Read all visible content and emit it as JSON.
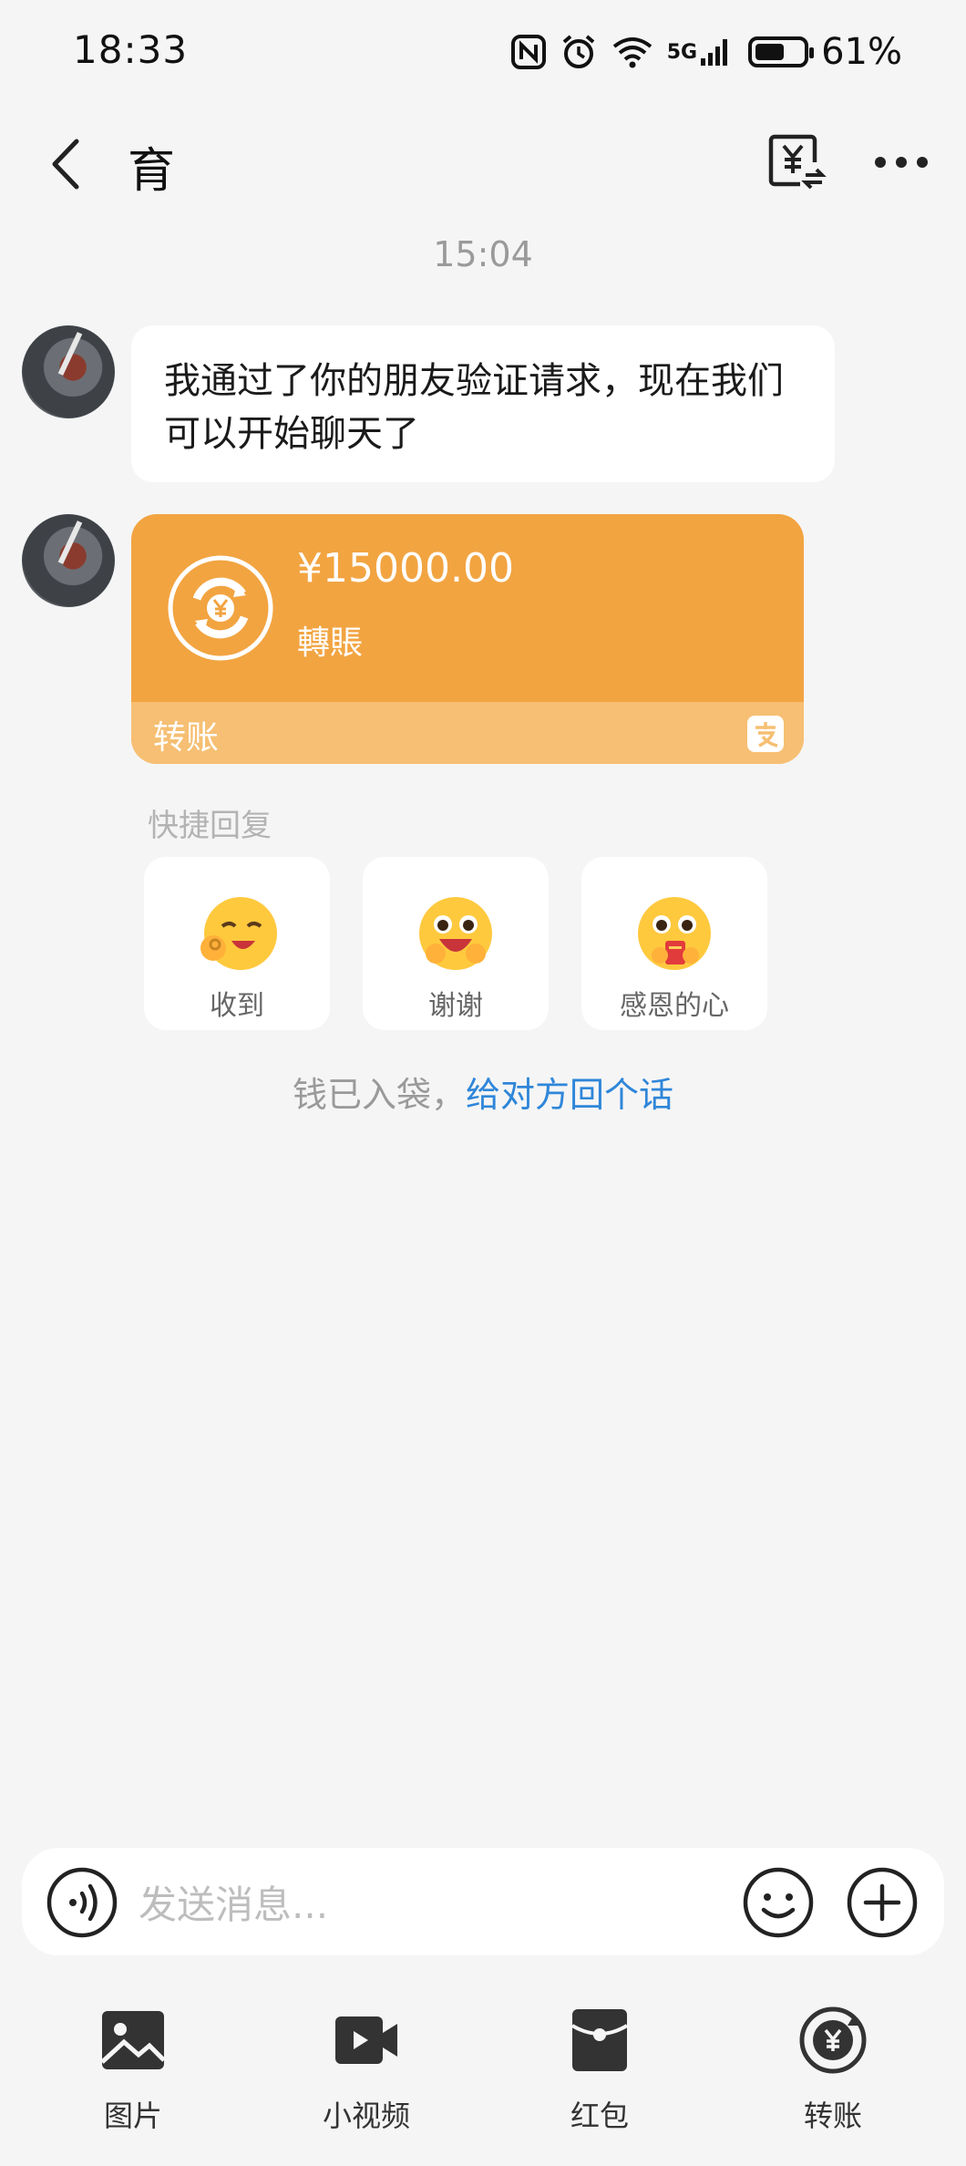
{
  "status_bar": {
    "time": "18:33",
    "network": "5G",
    "battery_percent": "61%",
    "battery_level": 0.61,
    "icons": [
      "nfc-icon",
      "alarm-icon",
      "wifi-icon",
      "signal-icon",
      "battery-icon"
    ]
  },
  "header": {
    "contact_name": "育",
    "icons": [
      "back-icon",
      "transfer-record-icon",
      "more-icon"
    ]
  },
  "chat": {
    "timestamp": "15:04",
    "messages": [
      {
        "type": "text",
        "text": "我通过了你的朋友验证请求，现在我们可以开始聊天了"
      },
      {
        "type": "transfer",
        "amount": "¥15000.00",
        "status": "轉賬",
        "footer_label": "转账",
        "accent_color": "#f2a441"
      }
    ],
    "quick_reply": {
      "title": "快捷回复",
      "items": [
        {
          "label": "收到",
          "icon": "ok-hand-emoji-icon"
        },
        {
          "label": "谢谢",
          "icon": "thanks-emoji-icon"
        },
        {
          "label": "感恩的心",
          "icon": "grateful-emoji-icon"
        }
      ]
    },
    "hint_text": "钱已入袋，",
    "hint_link": "给对方回个话"
  },
  "input": {
    "placeholder": "发送消息..."
  },
  "tools": [
    {
      "label": "图片",
      "icon": "image-icon"
    },
    {
      "label": "小视频",
      "icon": "video-icon"
    },
    {
      "label": "红包",
      "icon": "red-packet-icon"
    },
    {
      "label": "转账",
      "icon": "transfer-icon"
    }
  ]
}
